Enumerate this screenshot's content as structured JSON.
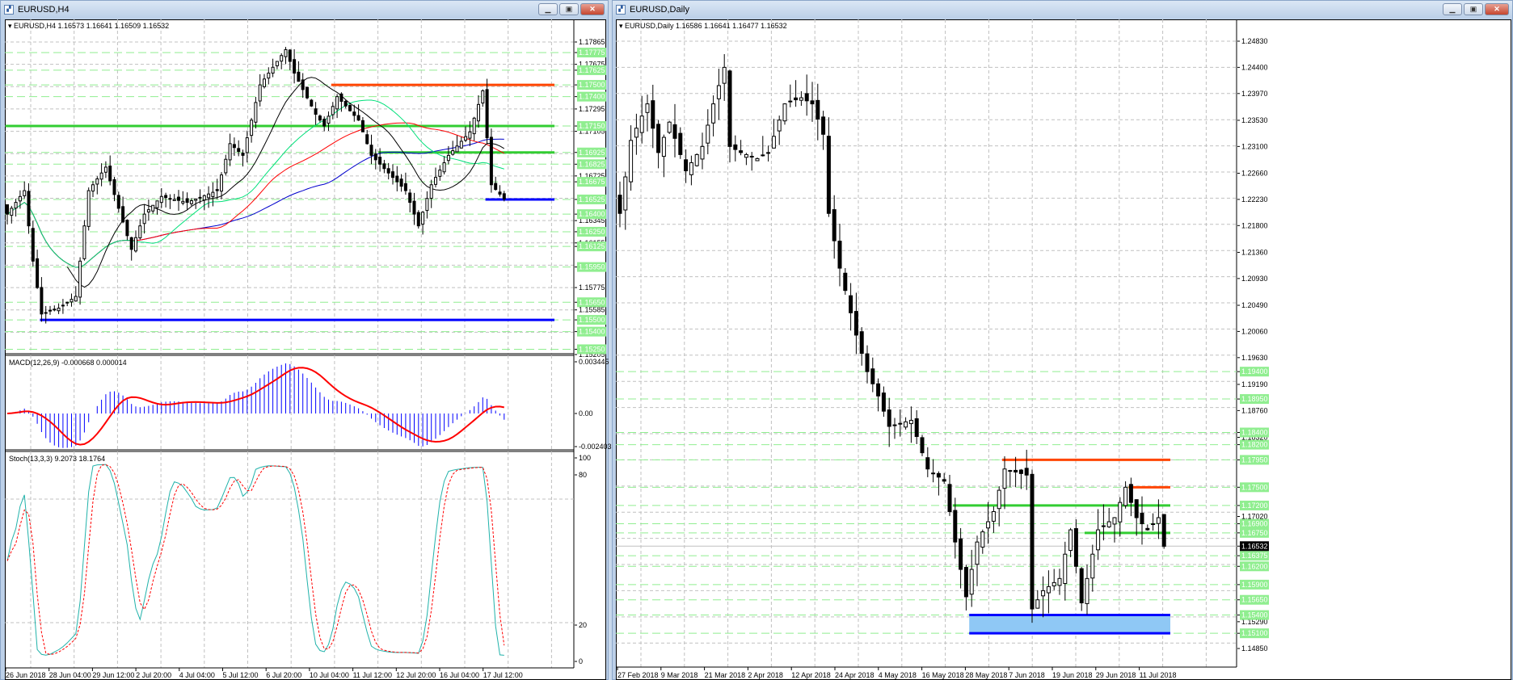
{
  "left_window": {
    "title": "EURUSD,H4",
    "header": "EURUSD,H4  1.16573 1.16641 1.16509 1.16532",
    "macd_header": "MACD(12,26,9) -0.000668 0.000014",
    "stoch_header": "Stoch(13,3,3) 9.2073 18.1764",
    "price_labels": [
      "1.17865",
      "1.17675",
      "1.17295",
      "1.17105",
      "1.16725",
      "1.16345",
      "1.16155",
      "1.15775",
      "1.15585",
      "1.15205"
    ],
    "level_labels": [
      "1.17775",
      "1.17625",
      "1.17500",
      "1.17400",
      "1.17150",
      "1.16925",
      "1.16825",
      "1.16675",
      "1.16525",
      "1.16400",
      "1.16250",
      "1.16125",
      "1.15950",
      "1.15650",
      "1.15500",
      "1.15400",
      "1.15250"
    ],
    "macd_labels": [
      "0.003445",
      "0.00",
      "-0.002403"
    ],
    "stoch_labels": [
      "100",
      "80",
      "20",
      "0"
    ],
    "time_labels": [
      "26 Jun 2018",
      "28 Jun 04:00",
      "29 Jun 12:00",
      "2 Jul 20:00",
      "4 Jul 04:00",
      "5 Jul 12:00",
      "6 Jul 20:00",
      "10 Jul 04:00",
      "11 Jul 12:00",
      "12 Jul 20:00",
      "16 Jul 04:00",
      "17 Jul 12:00"
    ],
    "price_range": [
      1.15205,
      1.17865
    ],
    "price_path": [
      [
        0,
        1.164
      ],
      [
        4,
        1.166
      ],
      [
        6,
        1.16
      ],
      [
        8,
        1.1555
      ],
      [
        12,
        1.156
      ],
      [
        16,
        1.157
      ],
      [
        19,
        1.166
      ],
      [
        23,
        1.168
      ],
      [
        29,
        1.161
      ],
      [
        32,
        1.164
      ],
      [
        36,
        1.1655
      ],
      [
        42,
        1.165
      ],
      [
        49,
        1.166
      ],
      [
        52,
        1.17
      ],
      [
        55,
        1.169
      ],
      [
        59,
        1.175
      ],
      [
        65,
        1.178
      ],
      [
        67,
        1.176
      ],
      [
        72,
        1.1725
      ],
      [
        74,
        1.1715
      ],
      [
        77,
        1.174
      ],
      [
        82,
        1.172
      ],
      [
        85,
        1.169
      ],
      [
        89,
        1.1675
      ],
      [
        93,
        1.166
      ],
      [
        96,
        1.163
      ],
      [
        99,
        1.1665
      ],
      [
        103,
        1.169
      ],
      [
        108,
        1.171
      ],
      [
        111,
        1.1745
      ],
      [
        113,
        1.1665
      ],
      [
        116,
        1.1653
      ]
    ],
    "lines": [
      {
        "name": "resistance-red",
        "price": 1.175,
        "from": 76,
        "color": "#ff4500",
        "kind": "res"
      },
      {
        "name": "green-level-1",
        "price": 1.1715,
        "from": 0,
        "color": "#32cd32",
        "kind": "sup"
      },
      {
        "name": "green-level-2",
        "price": 1.16925,
        "from": 87,
        "color": "#32cd32",
        "kind": "sup"
      },
      {
        "name": "blue-level-1",
        "price": 1.16525,
        "from": 112,
        "color": "#0000ff",
        "kind": "sup"
      },
      {
        "name": "blue-level-2",
        "price": 1.155,
        "from": 8,
        "color": "#0000ff",
        "kind": "sup"
      }
    ]
  },
  "right_window": {
    "title": "EURUSD,Daily",
    "header": "EURUSD,Daily  1.16586 1.16641 1.16477 1.16532",
    "price_labels": [
      "1.24830",
      "1.24400",
      "1.23970",
      "1.23530",
      "1.23100",
      "1.22660",
      "1.22230",
      "1.21800",
      "1.21360",
      "1.20930",
      "1.20490",
      "1.20060",
      "1.19630",
      "1.19190",
      "1.18760",
      "1.18320",
      "1.17020",
      "1.15290",
      "1.14850"
    ],
    "level_labels": [
      "1.19400",
      "1.18950",
      "1.18400",
      "1.18200",
      "1.17950",
      "1.17500",
      "1.17200",
      "1.16900",
      "1.16750",
      "1.16375",
      "1.16200",
      "1.15900",
      "1.15650",
      "1.15400",
      "1.15100"
    ],
    "current_price": "1.16532",
    "time_labels": [
      "27 Feb 2018",
      "9 Mar 2018",
      "21 Mar 2018",
      "2 Apr 2018",
      "12 Apr 2018",
      "24 Apr 2018",
      "4 May 2018",
      "16 May 2018",
      "28 May 2018",
      "7 Jun 2018",
      "19 Jun 2018",
      "29 Jun 2018",
      "11 Jul 2018"
    ],
    "price_range": [
      1.1485,
      1.2483
    ],
    "price_path": [
      [
        0,
        1.22
      ],
      [
        2,
        1.232
      ],
      [
        5,
        1.238
      ],
      [
        7,
        1.23
      ],
      [
        9,
        1.235
      ],
      [
        12,
        1.227
      ],
      [
        15,
        1.231
      ],
      [
        17,
        1.238
      ],
      [
        19,
        1.244
      ],
      [
        20,
        1.231
      ],
      [
        22,
        1.23
      ],
      [
        25,
        1.229
      ],
      [
        27,
        1.23
      ],
      [
        30,
        1.238
      ],
      [
        33,
        1.239
      ],
      [
        35,
        1.238
      ],
      [
        37,
        1.233
      ],
      [
        38,
        1.22
      ],
      [
        40,
        1.211
      ],
      [
        43,
        1.2
      ],
      [
        45,
        1.194
      ],
      [
        47,
        1.19
      ],
      [
        49,
        1.185
      ],
      [
        53,
        1.186
      ],
      [
        56,
        1.178
      ],
      [
        59,
        1.176
      ],
      [
        61,
        1.166
      ],
      [
        63,
        1.157
      ],
      [
        65,
        1.166
      ],
      [
        68,
        1.171
      ],
      [
        70,
        1.178
      ],
      [
        74,
        1.177
      ],
      [
        75,
        1.155
      ],
      [
        77,
        1.158
      ],
      [
        80,
        1.16
      ],
      [
        82,
        1.168
      ],
      [
        84,
        1.156
      ],
      [
        87,
        1.168
      ],
      [
        90,
        1.17
      ],
      [
        92,
        1.175
      ],
      [
        94,
        1.17
      ],
      [
        96,
        1.168
      ],
      [
        98,
        1.17
      ],
      [
        99,
        1.1653
      ]
    ],
    "lines": [
      {
        "name": "resistance-red-1",
        "price": 1.1795,
        "from": 70,
        "color": "#ff4500"
      },
      {
        "name": "resistance-red-2",
        "price": 1.175,
        "from": 93,
        "color": "#ff4500"
      },
      {
        "name": "green-level-1",
        "price": 1.172,
        "from": 61,
        "color": "#32cd32"
      },
      {
        "name": "green-level-2",
        "price": 1.1675,
        "from": 85,
        "color": "#32cd32"
      }
    ],
    "support_zone": {
      "top": 1.154,
      "bottom": 1.151,
      "from": 64,
      "fill": "#8fc8f5",
      "edge": "#0000ff"
    }
  },
  "colors": {
    "level_label_bg": "#90ee90",
    "grid": "#c0c0c0",
    "level_dash": "#90ee90"
  }
}
